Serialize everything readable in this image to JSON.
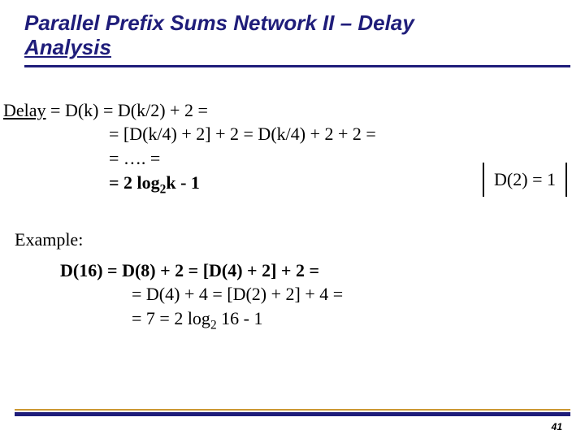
{
  "title": {
    "line1": "Parallel Prefix Sums Network II – Delay",
    "line2": "Analysis"
  },
  "delay": {
    "l1a": "Delay",
    "l1b": " = D(k) = D(k/2) + 2 =",
    "l2": "= [D(k/4) + 2] + 2 = D(k/4) + 2 + 2 =",
    "l3": "= …. =",
    "l4a": "= 2 log",
    "l4sub": "2",
    "l4b": "k - 1"
  },
  "d2box": "D(2) = 1",
  "example_label": "Example:",
  "example": {
    "l1": "D(16) = D(8) + 2 = [D(4) + 2] + 2 =",
    "l2": "= D(4) + 4 =  [D(2) + 2] + 4 =",
    "l3a": "= 7 = 2 log",
    "l3sub": "2",
    "l3b": " 16 - 1"
  },
  "page_number": "41"
}
